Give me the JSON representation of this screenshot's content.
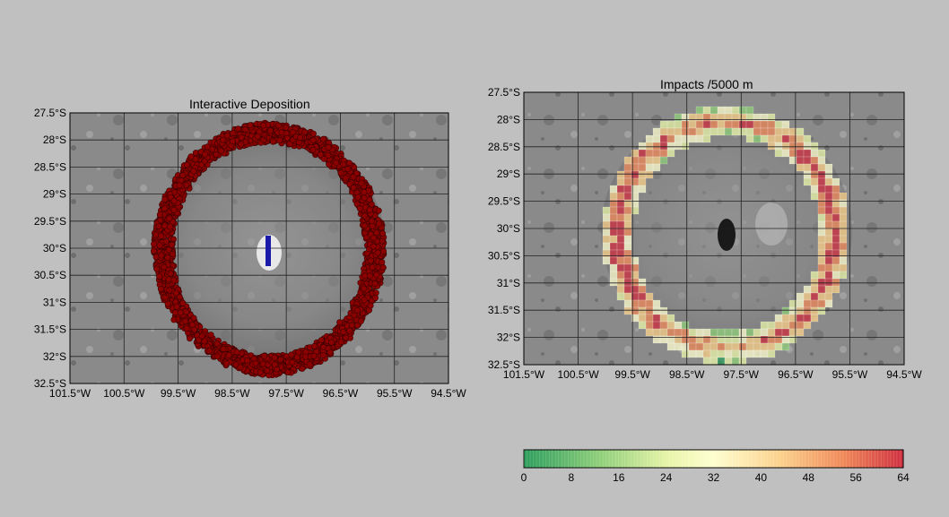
{
  "colors": {
    "background": "#c0c0c0",
    "deposit_fill": "#8b0000",
    "deposit_edge": "#3a0000",
    "vent_color": "#1a1aa8",
    "grid_color": "#222222"
  },
  "left_panel": {
    "title": "Interactive Deposition",
    "lat_labels": [
      "27.5°S",
      "28°S",
      "28.5°S",
      "29°S",
      "29.5°S",
      "30°S",
      "30.5°S",
      "31°S",
      "31.5°S",
      "32°S",
      "32.5°S"
    ],
    "lon_labels": [
      "101.5°W",
      "100.5°W",
      "99.5°W",
      "98.5°W",
      "97.5°W",
      "96.5°W",
      "95.5°W",
      "94.5°W"
    ],
    "ring_center": {
      "lon_w": 97.8,
      "lat_s": 30.1
    },
    "vent_label_icon": "vent-marker"
  },
  "right_panel": {
    "title": "Impacts /5000 m",
    "lat_labels": [
      "27.5°S",
      "28°S",
      "28.5°S",
      "29°S",
      "29.5°S",
      "30°S",
      "30.5°S",
      "31°S",
      "31.5°S",
      "32°S",
      "32.5°S"
    ],
    "lon_labels": [
      "101.5°W",
      "100.5°W",
      "99.5°W",
      "98.5°W",
      "97.5°W",
      "96.5°W",
      "95.5°W",
      "94.5°W"
    ]
  },
  "colorbar": {
    "ticks": [
      "0",
      "8",
      "16",
      "24",
      "32",
      "40",
      "48",
      "56",
      "64"
    ],
    "min": 0,
    "max": 64,
    "stops": [
      "#2e9e5e",
      "#8fcf7a",
      "#e8f5a8",
      "#ffffd0",
      "#fbd08a",
      "#f08a5a",
      "#d03040"
    ]
  }
}
